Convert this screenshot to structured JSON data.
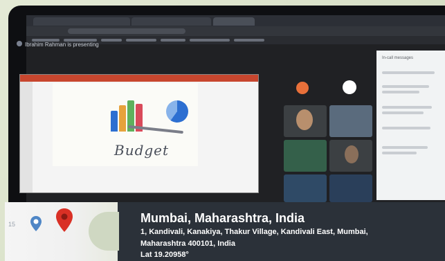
{
  "meeting": {
    "presenting_text": "Ibrahim Rahman is presenting",
    "slide_text": "Budget",
    "panel_title": "In-call messages"
  },
  "geotag": {
    "title": "Mumbai, Maharashtra, India",
    "address_line1": "1, Kandivali, Kanakiya, Thakur Village, Kandivali East, Mumbai,",
    "address_line2": "Maharashtra 400101, India",
    "latitude": "Lat 19.20958°",
    "map_label": "15"
  },
  "colors": {
    "pin_red": "#d93025",
    "pin_blue": "#4f86c6",
    "overlay": "#2c333c",
    "slide_accent": "#c8462e"
  }
}
